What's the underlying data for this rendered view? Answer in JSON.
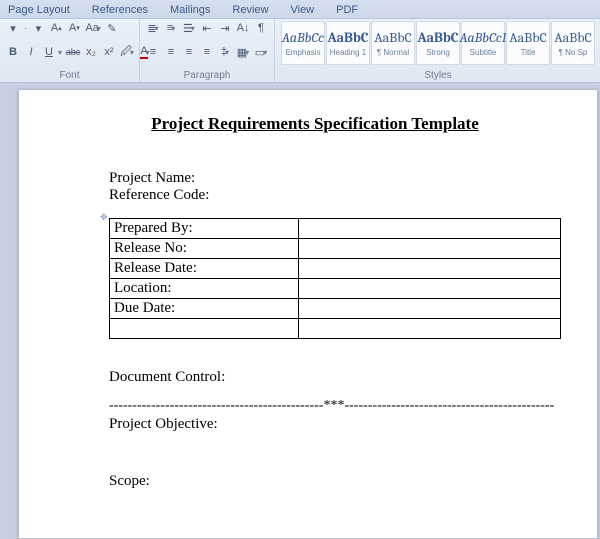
{
  "ribbon": {
    "tabs": [
      "Page Layout",
      "References",
      "Mailings",
      "Review",
      "View",
      "PDF"
    ],
    "groups": {
      "font": {
        "label": "Font"
      },
      "paragraph": {
        "label": "Paragraph"
      },
      "styles": {
        "label": "Styles"
      }
    },
    "font_row2": {
      "bold": "B",
      "italic": "I",
      "underline": "U",
      "strike": "abc",
      "sub": "x₂",
      "sup": "x²"
    },
    "styles_list": [
      {
        "sample": "AaBbCc",
        "name": "Emphasis",
        "italic": true
      },
      {
        "sample": "AaBbC",
        "name": "Heading 1",
        "bold": true
      },
      {
        "sample": "AaBbC",
        "name": "¶ Normal"
      },
      {
        "sample": "AaBbC",
        "name": "Strong",
        "bold": true
      },
      {
        "sample": "AaBbCcI",
        "name": "Subtitle",
        "italic": true
      },
      {
        "sample": "AaBbC",
        "name": "Title"
      },
      {
        "sample": "AaBbC",
        "name": "¶ No Sp"
      }
    ]
  },
  "document": {
    "title": "Project Requirements Specification Template",
    "fields": {
      "project_name_label": "Project Name:",
      "reference_code_label": "Reference Code:"
    },
    "table_rows": [
      {
        "label": "Prepared By:",
        "value": ""
      },
      {
        "label": "Release No:",
        "value": ""
      },
      {
        "label": "Release Date:",
        "value": ""
      },
      {
        "label": "Location:",
        "value": ""
      },
      {
        "label": "Due Date:",
        "value": ""
      },
      {
        "label": "",
        "value": ""
      }
    ],
    "sections": {
      "doc_control": "Document Control:",
      "separator": "----------------------------------------------***---------------------------------------------",
      "project_objective": "Project Objective:",
      "scope": "Scope:"
    }
  }
}
